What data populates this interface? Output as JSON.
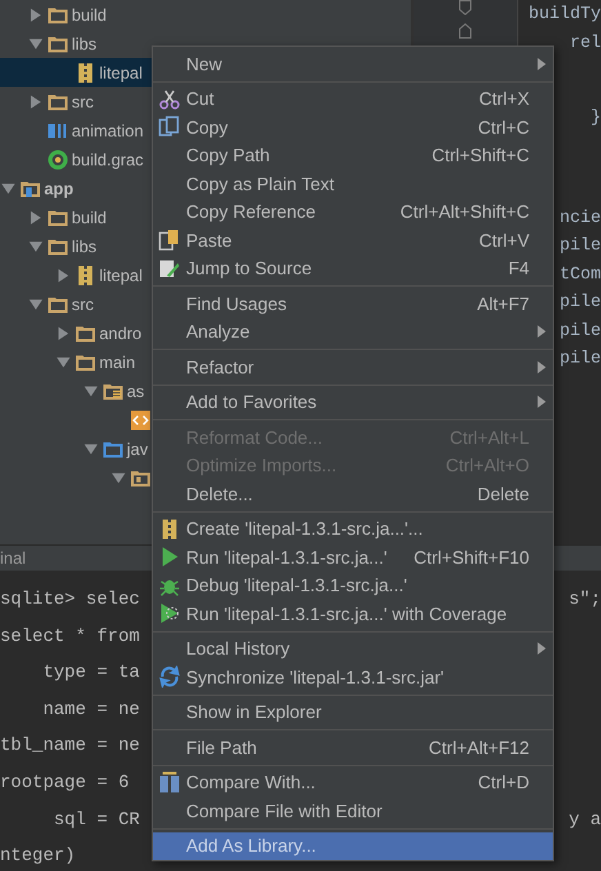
{
  "tree": {
    "items": [
      {
        "label": "build",
        "kind": "folder",
        "expanded": false,
        "selected": false
      },
      {
        "label": "libs",
        "kind": "folder",
        "expanded": true,
        "selected": false,
        "children": [
          {
            "label": "litepal",
            "kind": "jar",
            "selected": true
          }
        ]
      },
      {
        "label": "src",
        "kind": "folder",
        "expanded": false,
        "selected": false
      },
      {
        "label": "animation",
        "kind": "module-file",
        "selected": false
      },
      {
        "label": "build.grac",
        "kind": "gradle-file",
        "selected": false
      },
      {
        "label": "app",
        "kind": "module",
        "expanded": true,
        "selected": false,
        "children": [
          {
            "label": "build",
            "kind": "folder",
            "expanded": false,
            "selected": false
          },
          {
            "label": "libs",
            "kind": "folder",
            "expanded": true,
            "selected": false,
            "children": [
              {
                "label": "litepal",
                "kind": "jar",
                "expanded": false,
                "selected": false
              }
            ]
          },
          {
            "label": "src",
            "kind": "folder",
            "expanded": true,
            "selected": false,
            "children": [
              {
                "label": "andro",
                "kind": "folder",
                "expanded": false,
                "selected": false
              },
              {
                "label": "main",
                "kind": "folder",
                "expanded": true,
                "selected": false,
                "children": [
                  {
                    "label": "as",
                    "kind": "resource-folder",
                    "expanded": true,
                    "selected": false,
                    "children": [
                      {
                        "kind": "file",
                        "selected": false
                      }
                    ]
                  },
                  {
                    "label": "jav",
                    "kind": "source-folder",
                    "expanded": true,
                    "selected": false,
                    "children": [
                      {
                        "kind": "package",
                        "expanded": true,
                        "selected": false
                      }
                    ]
                  }
                ]
              }
            ]
          }
        ]
      }
    ]
  },
  "editor": {
    "blocks": [
      [
        "buildTy",
        "rel"
      ],
      [
        "}"
      ],
      [
        "ncie",
        "pile",
        "tCom",
        "pile",
        "pile",
        "pile"
      ]
    ]
  },
  "terminal": {
    "title": "inal",
    "lines": [
      {
        "left": "sqlite> selec",
        "right": "s\";"
      },
      {
        "left": "select * from"
      },
      {
        "left": "    type = ta"
      },
      {
        "left": "    name = ne"
      },
      {
        "left": "tbl_name = ne"
      },
      {
        "left": "rootpage = 6"
      },
      {
        "left": "     sql = CR",
        "right": "y a"
      },
      {
        "left": "nteger)"
      }
    ]
  },
  "context_menu": {
    "groups": [
      [
        {
          "label": "New",
          "has_submenu": true,
          "disabled": false,
          "selected": false
        }
      ],
      [
        {
          "label": "Cut",
          "shortcut": "Ctrl+X",
          "has_submenu": false,
          "disabled": false,
          "selected": false
        },
        {
          "label": "Copy",
          "shortcut": "Ctrl+C",
          "has_submenu": false,
          "disabled": false,
          "selected": false
        },
        {
          "label": "Copy Path",
          "shortcut": "Ctrl+Shift+C",
          "has_submenu": false,
          "disabled": false,
          "selected": false
        },
        {
          "label": "Copy as Plain Text",
          "has_submenu": false,
          "disabled": false,
          "selected": false
        },
        {
          "label": "Copy Reference",
          "shortcut": "Ctrl+Alt+Shift+C",
          "has_submenu": false,
          "disabled": false,
          "selected": false
        },
        {
          "label": "Paste",
          "shortcut": "Ctrl+V",
          "has_submenu": false,
          "disabled": false,
          "selected": false
        },
        {
          "label": "Jump to Source",
          "shortcut": "F4",
          "has_submenu": false,
          "disabled": false,
          "selected": false
        }
      ],
      [
        {
          "label": "Find Usages",
          "shortcut": "Alt+F7",
          "has_submenu": false,
          "disabled": false,
          "selected": false
        },
        {
          "label": "Analyze",
          "has_submenu": true,
          "disabled": false,
          "selected": false
        }
      ],
      [
        {
          "label": "Refactor",
          "has_submenu": true,
          "disabled": false,
          "selected": false
        }
      ],
      [
        {
          "label": "Add to Favorites",
          "has_submenu": true,
          "disabled": false,
          "selected": false
        }
      ],
      [
        {
          "label": "Reformat Code...",
          "shortcut": "Ctrl+Alt+L",
          "has_submenu": false,
          "disabled": true,
          "selected": false
        },
        {
          "label": "Optimize Imports...",
          "shortcut": "Ctrl+Alt+O",
          "has_submenu": false,
          "disabled": true,
          "selected": false
        },
        {
          "label": "Delete...",
          "shortcut": "Delete",
          "has_submenu": false,
          "disabled": false,
          "selected": false
        }
      ],
      [
        {
          "label": "Create 'litepal-1.3.1-src.ja...'...",
          "has_submenu": false,
          "disabled": false,
          "selected": false
        },
        {
          "label": "Run 'litepal-1.3.1-src.ja...'",
          "shortcut": "Ctrl+Shift+F10",
          "has_submenu": false,
          "disabled": false,
          "selected": false
        },
        {
          "label": "Debug 'litepal-1.3.1-src.ja...'",
          "has_submenu": false,
          "disabled": false,
          "selected": false
        },
        {
          "label": "Run 'litepal-1.3.1-src.ja...' with Coverage",
          "has_submenu": false,
          "disabled": false,
          "selected": false
        }
      ],
      [
        {
          "label": "Local History",
          "has_submenu": true,
          "disabled": false,
          "selected": false
        },
        {
          "label": "Synchronize 'litepal-1.3.1-src.jar'",
          "has_submenu": false,
          "disabled": false,
          "selected": false
        }
      ],
      [
        {
          "label": "Show in Explorer",
          "has_submenu": false,
          "disabled": false,
          "selected": false
        }
      ],
      [
        {
          "label": "File Path",
          "shortcut": "Ctrl+Alt+F12",
          "has_submenu": false,
          "disabled": false,
          "selected": false
        }
      ],
      [
        {
          "label": "Compare With...",
          "shortcut": "Ctrl+D",
          "has_submenu": false,
          "disabled": false,
          "selected": false
        },
        {
          "label": "Compare File with Editor",
          "has_submenu": false,
          "disabled": false,
          "selected": false
        }
      ],
      [
        {
          "label": "Add As Library...",
          "has_submenu": false,
          "disabled": false,
          "selected": true
        }
      ]
    ]
  }
}
